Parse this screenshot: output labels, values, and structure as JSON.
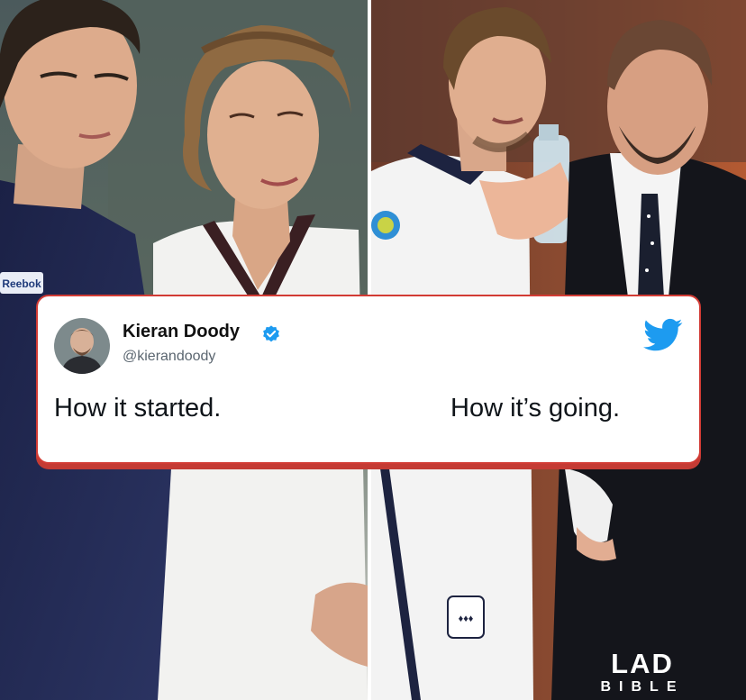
{
  "tweet": {
    "author_name": "Kieran Doody",
    "handle": "@kierandoody",
    "caption_left": "How it started.",
    "caption_right": "How it’s going.",
    "verified": true
  },
  "panels": {
    "left_photo": "photo-before",
    "right_photo": "photo-after",
    "left_logo_text": "Reebok"
  },
  "logo": {
    "main": "LAD",
    "sub": "BIBLE"
  },
  "colors": {
    "twitter_blue": "#1d9bf0",
    "card_border": "#d23b34",
    "text": "#0f1419",
    "handle": "#5b6670"
  },
  "icons": [
    "verified-badge-icon",
    "twitter-bird-icon"
  ]
}
